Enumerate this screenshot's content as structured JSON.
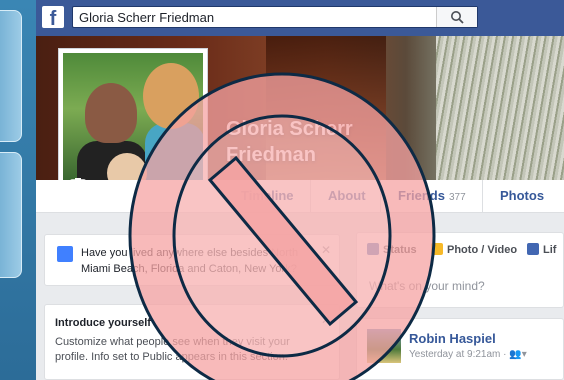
{
  "header": {
    "logo_letter": "f",
    "search_value": "Gloria Scherr Friedman"
  },
  "profile": {
    "name_line1": "Gloria Scherr",
    "name_line2": "Friedman"
  },
  "tabs": [
    {
      "label": "Timeline"
    },
    {
      "label": "About"
    },
    {
      "label": "Friends",
      "count": "377"
    },
    {
      "label": "Photos"
    }
  ],
  "left_cards": {
    "places_prompt": "Have you lived anywhere else besides North Miami Beach, Florida and Caton, New York?",
    "intro_title": "Introduce yourself",
    "intro_desc": "Customize what people see when they visit your profile. Info set to Public appears in this section."
  },
  "composer": {
    "status_label": "Status",
    "photo_label": "Photo / Video",
    "life_label": "Lif",
    "placeholder": "What's on your mind?"
  },
  "post": {
    "author": "Robin Haspiel",
    "meta": "Yesterday at 9:21am · "
  },
  "colors": {
    "facebook_blue": "#3b5998",
    "link_blue": "#365899",
    "prohibit_red": "#f5a3a3",
    "prohibit_outline": "#0d2a45"
  }
}
